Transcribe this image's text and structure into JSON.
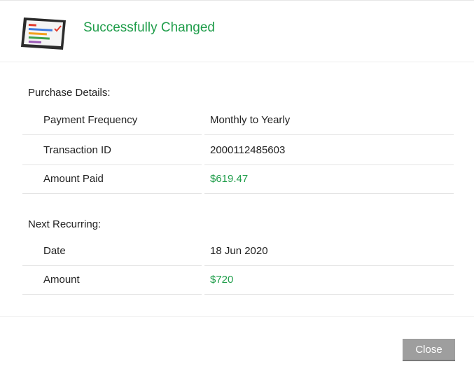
{
  "header": {
    "title": "Successfully Changed",
    "icon": "tablet-report-icon"
  },
  "purchase": {
    "heading": "Purchase Details:",
    "rows": [
      {
        "label": "Payment Frequency",
        "value": "Monthly to Yearly"
      },
      {
        "label": "Transaction ID",
        "value": "2000112485603"
      },
      {
        "label": "Amount Paid",
        "value": "$619.47"
      }
    ]
  },
  "recurring": {
    "heading": "Next Recurring:",
    "rows": [
      {
        "label": "Date",
        "value": "18 Jun 2020"
      },
      {
        "label": "Amount",
        "value": "$720"
      }
    ]
  },
  "footer": {
    "close_label": "Close"
  },
  "colors": {
    "accent_green": "#1f9d4a",
    "button_gray": "#9e9e9e"
  }
}
